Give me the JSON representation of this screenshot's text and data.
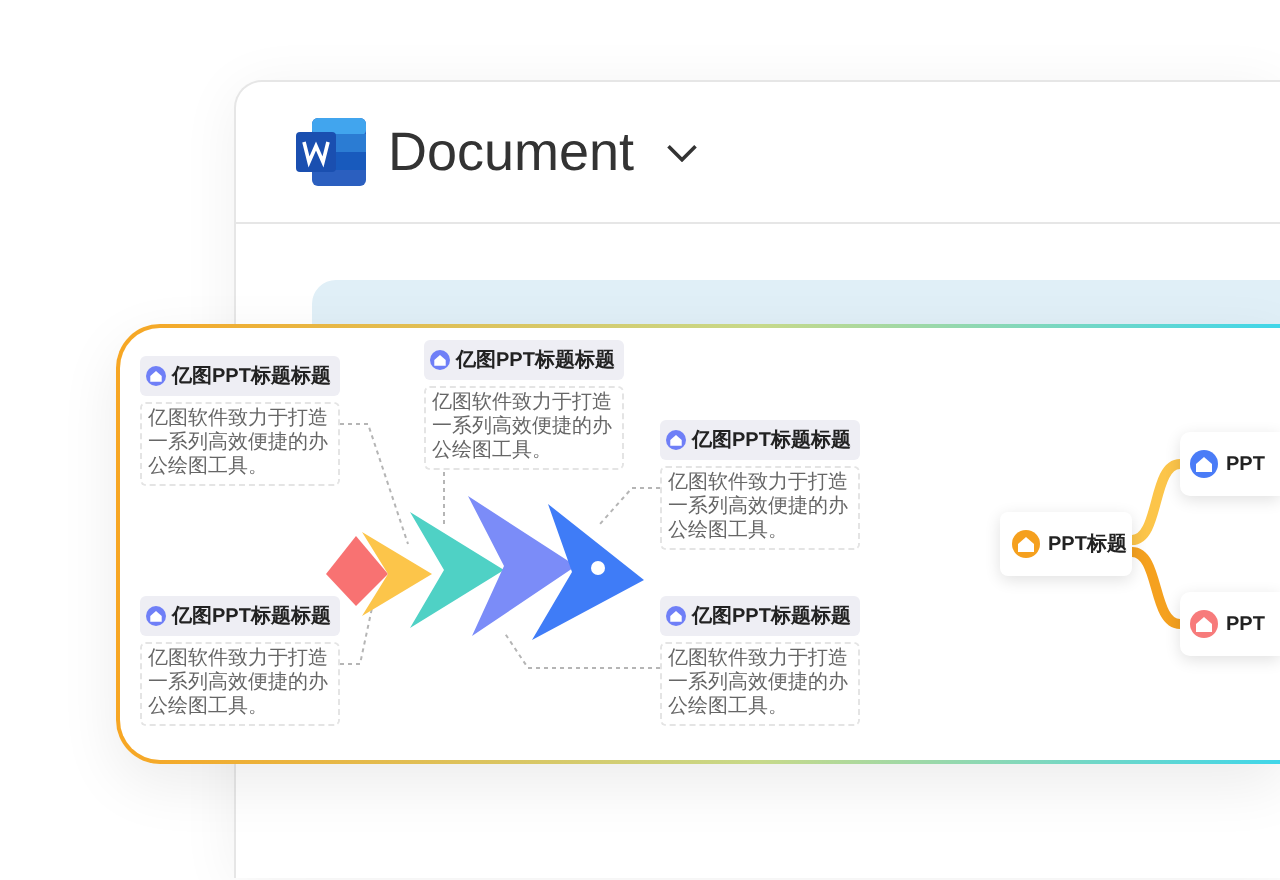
{
  "window": {
    "title": "Document"
  },
  "diagram": {
    "nodes": [
      {
        "title": "亿图PPT标题标题",
        "text": "亿图软件致力于打造一系列高效便捷的办公绘图工具。"
      },
      {
        "title": "亿图PPT标题标题",
        "text": "亿图软件致力于打造一系列高效便捷的办公绘图工具。"
      },
      {
        "title": "亿图PPT标题标题",
        "text": "亿图软件致力于打造一系列高效便捷的办公绘图工具。"
      },
      {
        "title": "亿图PPT标题标题",
        "text": "亿图软件致力于打造一系列高效便捷的办公绘图工具。"
      },
      {
        "title": "亿图PPT标题标题",
        "text": "亿图软件致力于打造一系列高效便捷的办公绘图工具。"
      }
    ]
  },
  "mind_map": {
    "root": {
      "label": "PPT标题",
      "color": "#f5a01e"
    },
    "children": [
      {
        "label": "PPT",
        "color": "#4a7cf7"
      },
      {
        "label": "PPT",
        "color": "#f77b7b"
      }
    ]
  }
}
